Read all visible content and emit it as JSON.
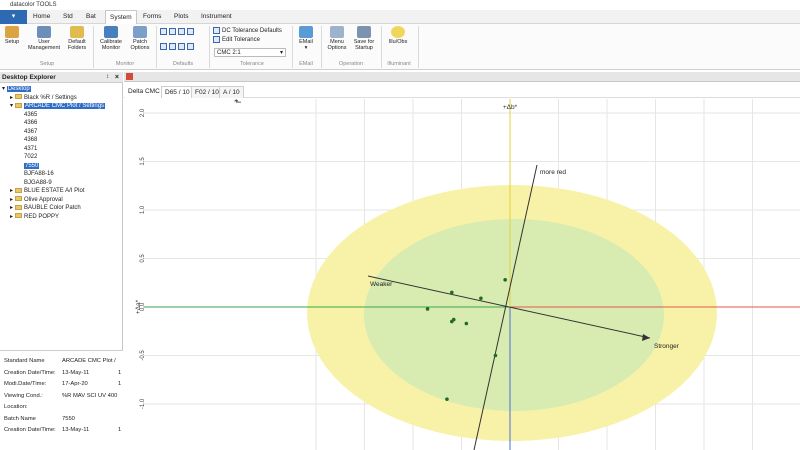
{
  "app": {
    "title": "datacolor TOOLS"
  },
  "ribbon_tabs": [
    "Home",
    "Std",
    "Bat",
    "System",
    "Forms",
    "Plots",
    "Instrument"
  ],
  "active_ribbon_tab": "System",
  "ribbon": {
    "setup": "Setup",
    "user_management": "User Management",
    "default_folders": "Default Folders",
    "calibrate_monitor": "Calibrate Monitor",
    "patch_options": "Patch Options",
    "dc_tolerance_defaults": "DC Tolerance Defaults",
    "edit_tolerance": "Edit Tolerance",
    "tolerance_select": "CMC 2:1",
    "email": "EMail",
    "menu_options": "Menu Options",
    "save_for_startup": "Save for Startup",
    "illu_obs": "Illu/Obs",
    "groups": [
      "Setup",
      "Monitor",
      "Defaults",
      "Tolerance",
      "EMail",
      "Operation",
      "Illuminant"
    ]
  },
  "explorer": {
    "title": "Desktop Explorer",
    "root": "Desktop",
    "items": [
      {
        "label": "Black %R / Settings",
        "level": 1,
        "folder": true
      },
      {
        "label": "ARCADE CMC Plot / Settings",
        "level": 1,
        "folder": true,
        "selected": true
      },
      {
        "label": "4365",
        "level": 2
      },
      {
        "label": "4366",
        "level": 2
      },
      {
        "label": "4367",
        "level": 2
      },
      {
        "label": "4368",
        "level": 2
      },
      {
        "label": "4371",
        "level": 2
      },
      {
        "label": "7022",
        "level": 2
      },
      {
        "label": "7550",
        "level": 2,
        "selected": true
      },
      {
        "label": "BJFA88-16",
        "level": 2
      },
      {
        "label": "BJGA88-9",
        "level": 2
      },
      {
        "label": "BLUE ESTATE A/I Plot",
        "level": 1,
        "folder": true
      },
      {
        "label": "Olive Approval",
        "level": 1,
        "folder": true
      },
      {
        "label": "BAUBLE Color Patch",
        "level": 1,
        "folder": true
      },
      {
        "label": "RED POPPY",
        "level": 1,
        "folder": true
      }
    ]
  },
  "properties": [
    {
      "name": "Standard Name",
      "value": "ARCADE CMC Plot /"
    },
    {
      "name": "Creation Date/Time:",
      "value": "13-May-11",
      "extra": "1"
    },
    {
      "name": "Modi.Date/Time:",
      "value": "17-Apr-20",
      "extra": "1"
    },
    {
      "name": "Viewing Cond.:",
      "value": "%R MAV  SCI UV 400"
    },
    {
      "name": "Location:",
      "value": ""
    },
    {
      "name": "Batch Name",
      "value": "7550"
    },
    {
      "name": "Creation Date/Time:",
      "value": "13-May-11",
      "extra": "1"
    }
  ],
  "view_tabs": [
    "Delta CMC",
    "D65 / 10",
    "F02 / 10",
    "A / 10"
  ],
  "active_view_tab": "D65 / 10",
  "colors": {
    "accent": "#2d6ab3",
    "outer_ellipse": "#f7f2a8",
    "inner_ellipse": "#d8ebb0"
  },
  "chart_data": {
    "type": "scatter",
    "title": "+Δb*",
    "ylabel": "+Δa*",
    "ylim": [
      -1.5,
      2.0
    ],
    "xlim": [
      -2.0,
      1.5
    ],
    "yticks": [
      "2.0",
      "1.5",
      "1.0",
      "0.5",
      "0.0",
      "-0.5",
      "-1.0"
    ],
    "x": [
      -0.6,
      -0.85,
      -0.6,
      -0.58,
      -0.45,
      -0.3,
      -0.05,
      -0.15,
      -0.65
    ],
    "y": [
      0.15,
      -0.02,
      -0.15,
      -0.13,
      -0.17,
      0.09,
      0.28,
      -0.5,
      -0.95
    ],
    "annotations": [
      "more red",
      "Weaker",
      "Stronger"
    ],
    "grid": true
  }
}
